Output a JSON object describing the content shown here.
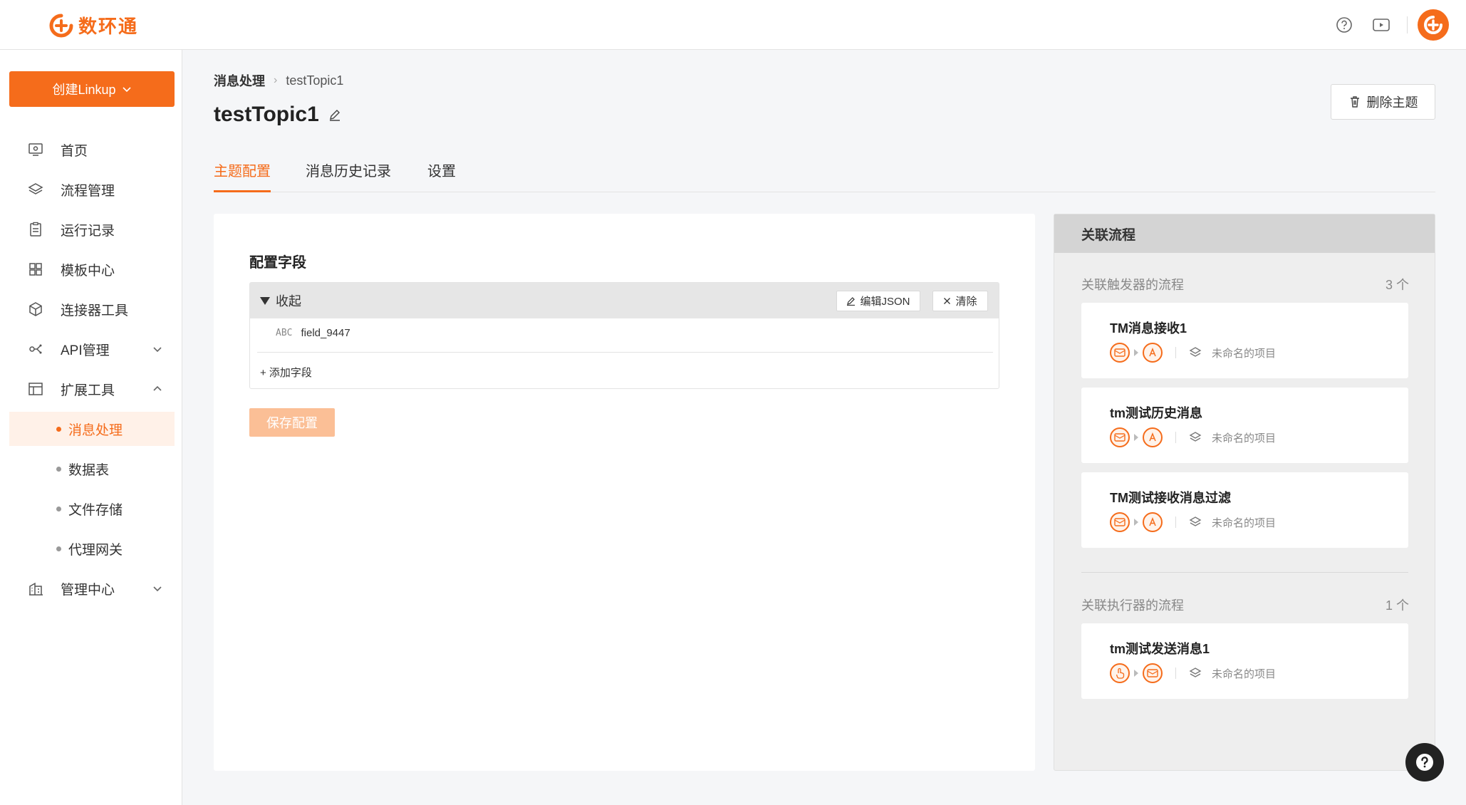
{
  "app": {
    "logo_text": "数环通",
    "brand_color": "#f56c1b"
  },
  "topbar": {
    "icons": [
      "help-circle-icon",
      "video-play-icon"
    ],
    "avatar_icon": "brand-avatar-icon"
  },
  "sidebar": {
    "create_button": "创建Linkup",
    "items": [
      {
        "label": "首页",
        "icon": "monitor-icon"
      },
      {
        "label": "流程管理",
        "icon": "layers-icon"
      },
      {
        "label": "运行记录",
        "icon": "clipboard-icon"
      },
      {
        "label": "模板中心",
        "icon": "grid-icon"
      },
      {
        "label": "连接器工具",
        "icon": "cube-icon"
      },
      {
        "label": "API管理",
        "icon": "api-icon",
        "expanded": false
      },
      {
        "label": "扩展工具",
        "icon": "layout-icon",
        "expanded": true
      },
      {
        "label": "管理中心",
        "icon": "building-icon",
        "expanded": false
      }
    ],
    "sub_items": [
      {
        "label": "消息处理",
        "active": true
      },
      {
        "label": "数据表",
        "active": false
      },
      {
        "label": "文件存储",
        "active": false
      },
      {
        "label": "代理网关",
        "active": false
      }
    ]
  },
  "breadcrumb": {
    "parent": "消息处理",
    "current": "testTopic1"
  },
  "page": {
    "title": "testTopic1",
    "delete_button": "删除主题"
  },
  "tabs": [
    {
      "label": "主题配置",
      "active": true
    },
    {
      "label": "消息历史记录",
      "active": false
    },
    {
      "label": "设置",
      "active": false
    }
  ],
  "config": {
    "title": "配置字段",
    "collapse_label": "收起",
    "edit_json": "编辑JSON",
    "clear": "清除",
    "field": {
      "type_label": "ABC",
      "name": "field_9447"
    },
    "add_field": "+ 添加字段",
    "save_button": "保存配置"
  },
  "related": {
    "header": "关联流程",
    "trigger_section": {
      "label": "关联触发器的流程",
      "count": "3 个"
    },
    "executor_section": {
      "label": "关联执行器的流程",
      "count": "1 个"
    },
    "trigger_flows": [
      {
        "name": "TM消息接收1",
        "project": "未命名的项目"
      },
      {
        "name": "tm测试历史消息",
        "project": "未命名的项目"
      },
      {
        "name": "TM测试接收消息过滤",
        "project": "未命名的项目"
      }
    ],
    "executor_flows": [
      {
        "name": "tm测试发送消息1",
        "project": "未命名的项目"
      }
    ]
  }
}
